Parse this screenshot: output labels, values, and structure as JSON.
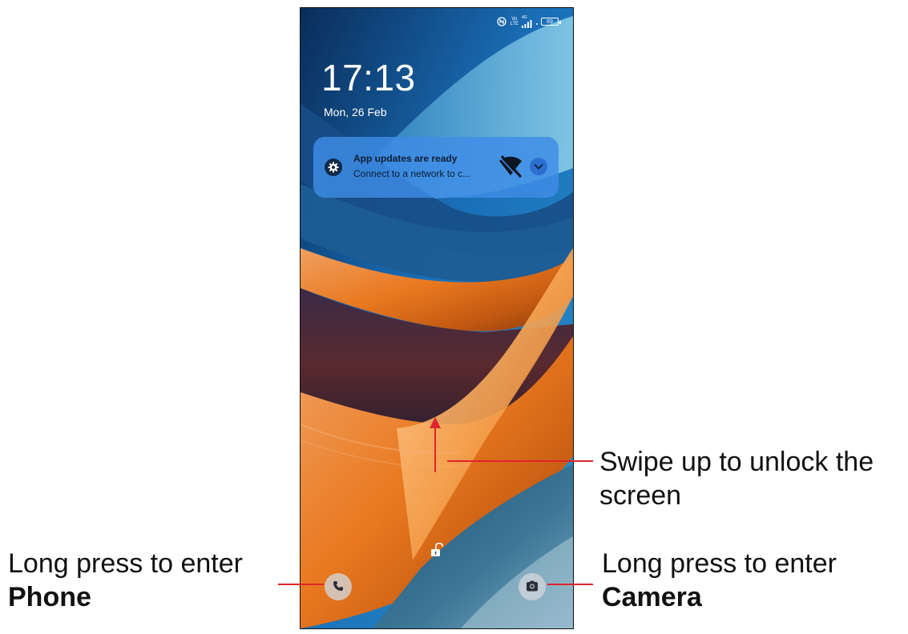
{
  "status_bar": {
    "lte_top": "Vo",
    "lte_bottom": "LTE",
    "network": "4G",
    "battery": "69"
  },
  "lock_screen": {
    "time": "17:13",
    "date": "Mon, 26 Feb"
  },
  "notification": {
    "title": "App updates are ready",
    "body": "Connect to a network to c..."
  },
  "icons": {
    "nfc": "nfc-icon",
    "signal": "signal-icon",
    "settings": "gear-icon",
    "wifi_off": "wifi-off-icon",
    "expand": "chevron-down-icon",
    "lock": "unlock-icon",
    "phone": "phone-icon",
    "camera": "camera-icon"
  },
  "annotations": {
    "swipe": "Swipe up to unlock the screen",
    "phone_line1": "Long press to enter",
    "phone_line2": "Phone",
    "camera_line1": "Long press to enter",
    "camera_line2": "Camera"
  },
  "colors": {
    "annotation_line": "#e0242b",
    "notification_bg": "#3e8ce6"
  }
}
